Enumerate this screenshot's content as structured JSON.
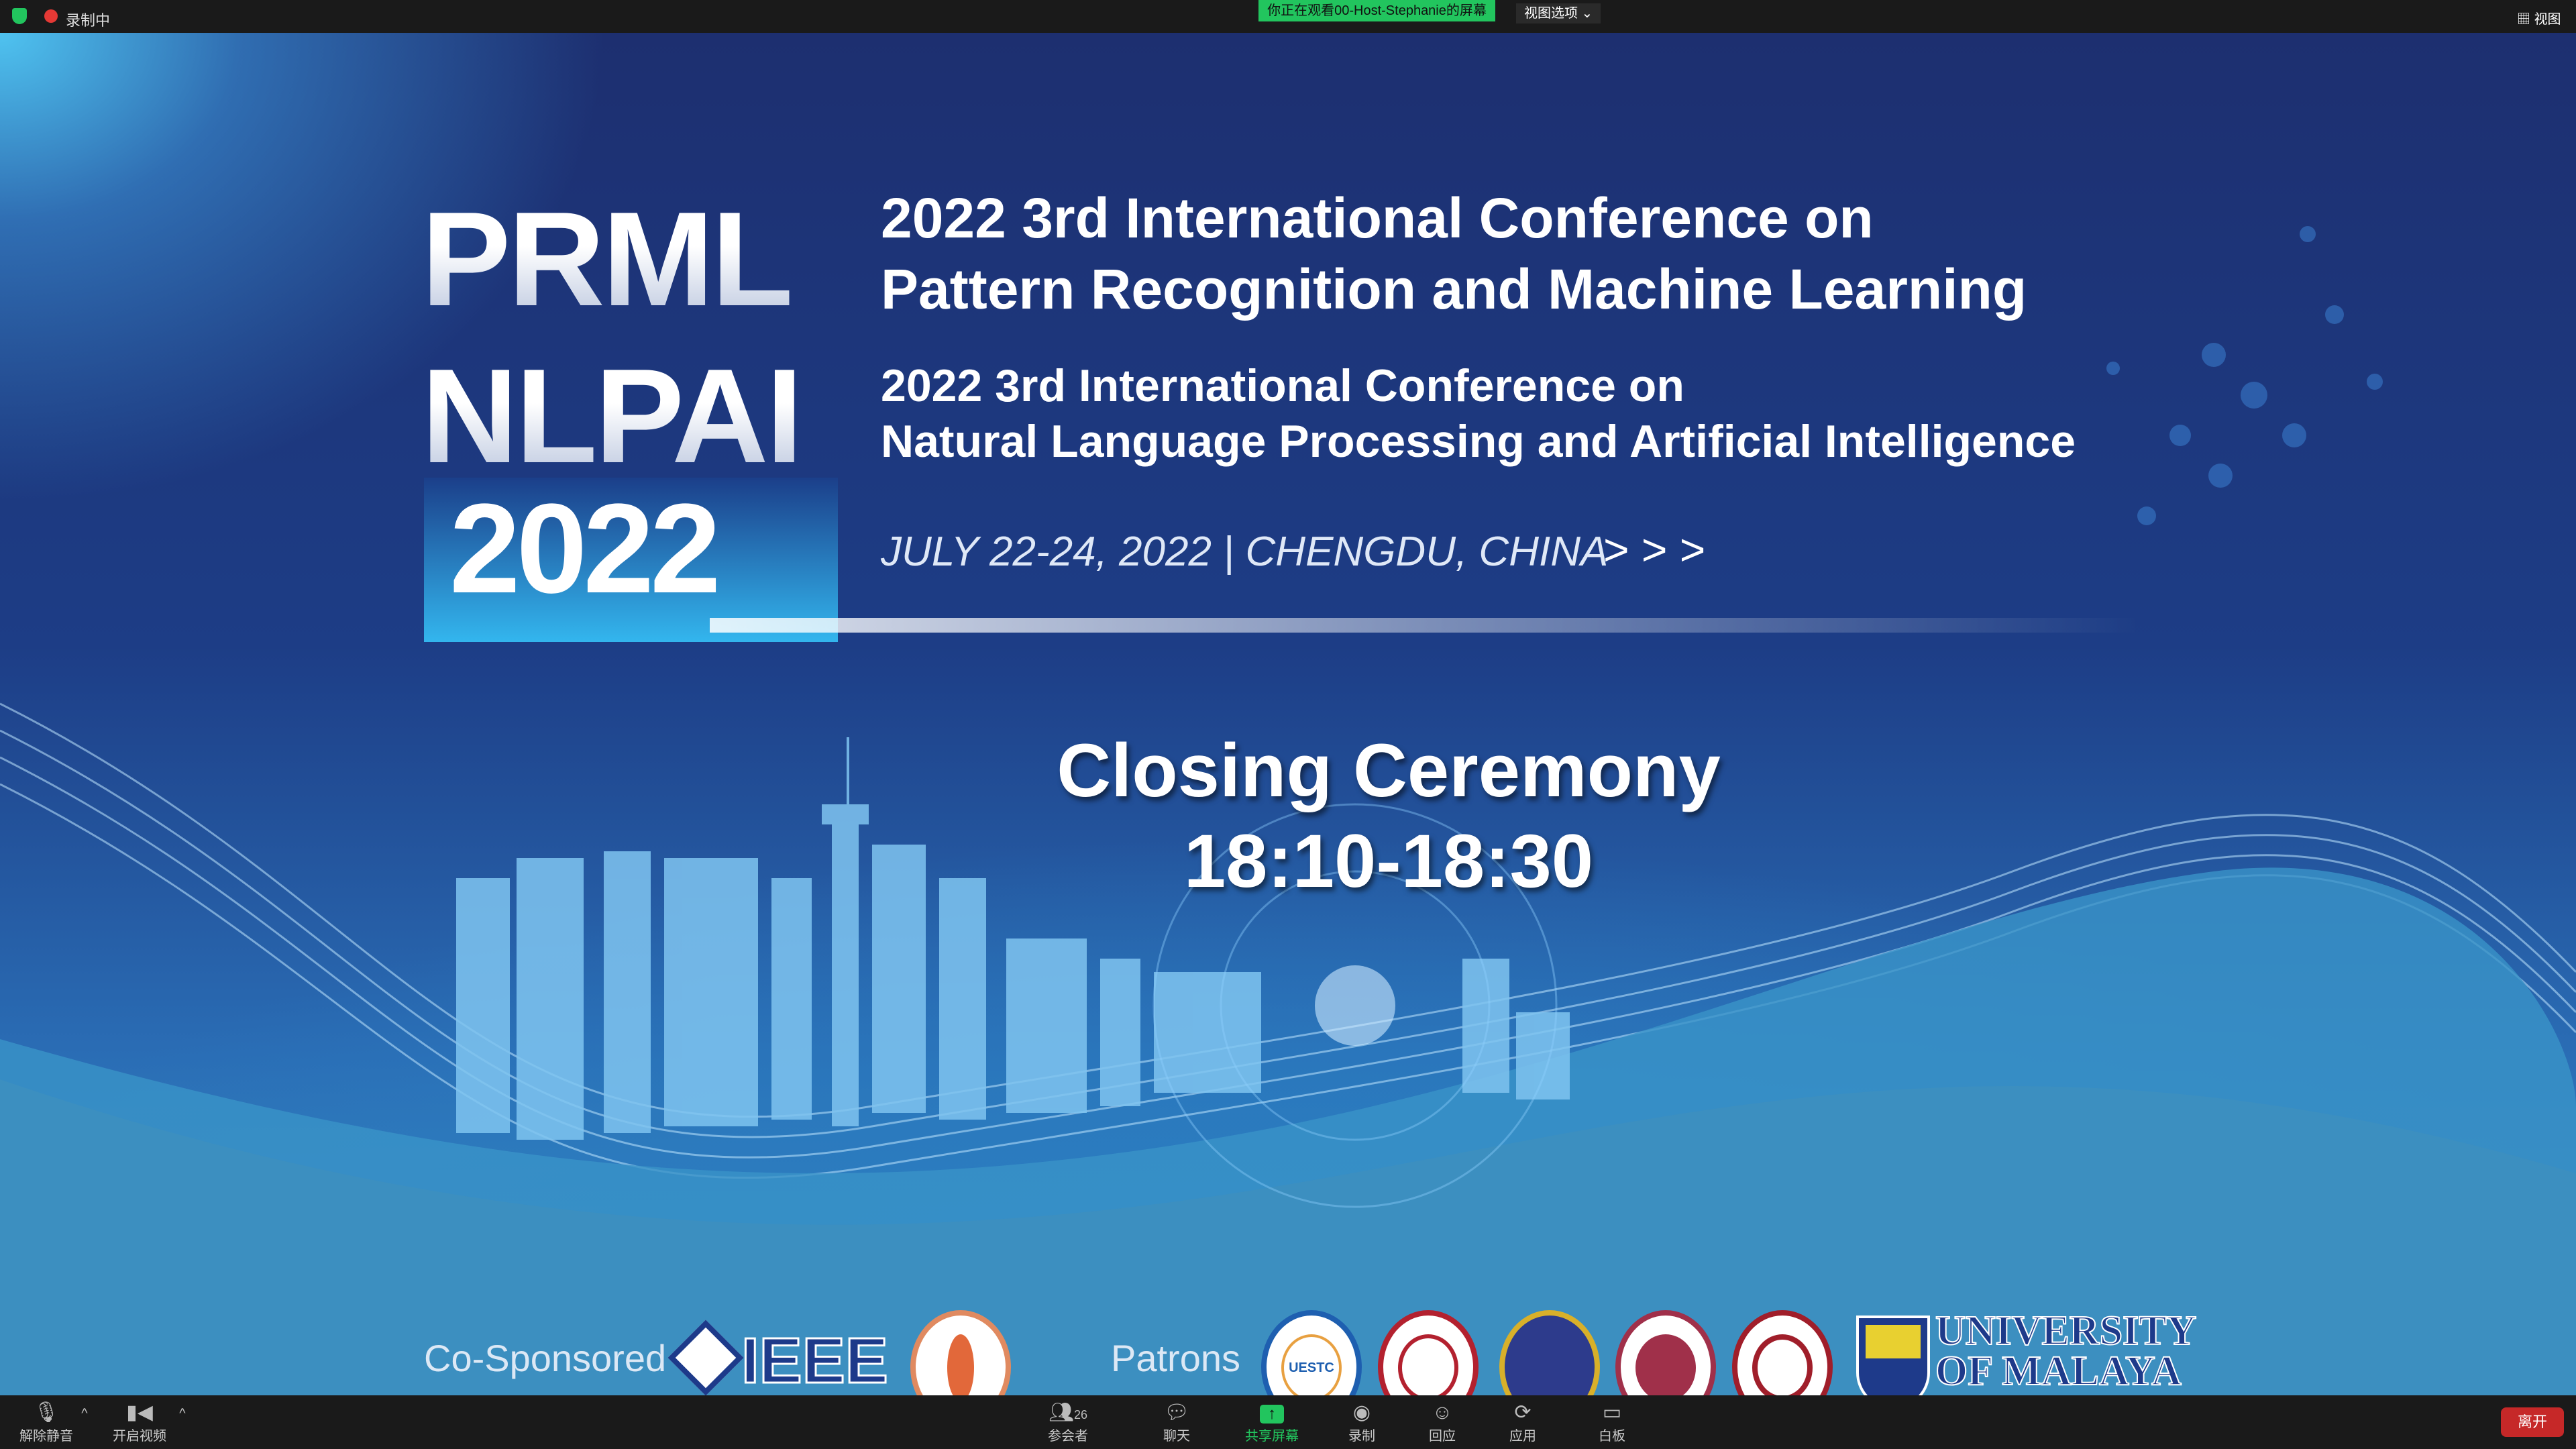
{
  "topbar": {
    "recording_label": "录制中",
    "viewing_banner": "你正在观看00-Host-Stephanie的屏幕",
    "view_options": "视图选项",
    "view_button": "视图",
    "accent_green": "#22c55e"
  },
  "slide": {
    "logo_line1": "PRML",
    "logo_line2": "NLPAI",
    "logo_year": "2022",
    "conf1_line1": "2022 3rd International Conference on",
    "conf1_line2": "Pattern Recognition and Machine Learning",
    "conf2_line1": "2022 3rd International Conference on",
    "conf2_line2": "Natural Language Processing and Artificial Intelligence",
    "date_location": "JULY 22-24, 2022 | CHENGDU, CHINA",
    "arrows": "> > >",
    "event": "Closing Ceremony",
    "time": "18:10-18:30",
    "co_sponsored": "Co-Sponsored",
    "ieee": "IEEE",
    "patrons": "Patrons",
    "um_line1": "UNIVERSITY",
    "um_line2": "OF MALAYA",
    "uestc": "UESTC"
  },
  "toolbar": {
    "unmute": "解除静音",
    "start_video": "开启视频",
    "participants": "参会者",
    "participant_count": "26",
    "chat": "聊天",
    "share_screen": "共享屏幕",
    "record": "录制",
    "reactions": "回应",
    "apps": "应用",
    "whiteboard": "白板",
    "leave": "离开",
    "leave_color": "#c62828"
  }
}
